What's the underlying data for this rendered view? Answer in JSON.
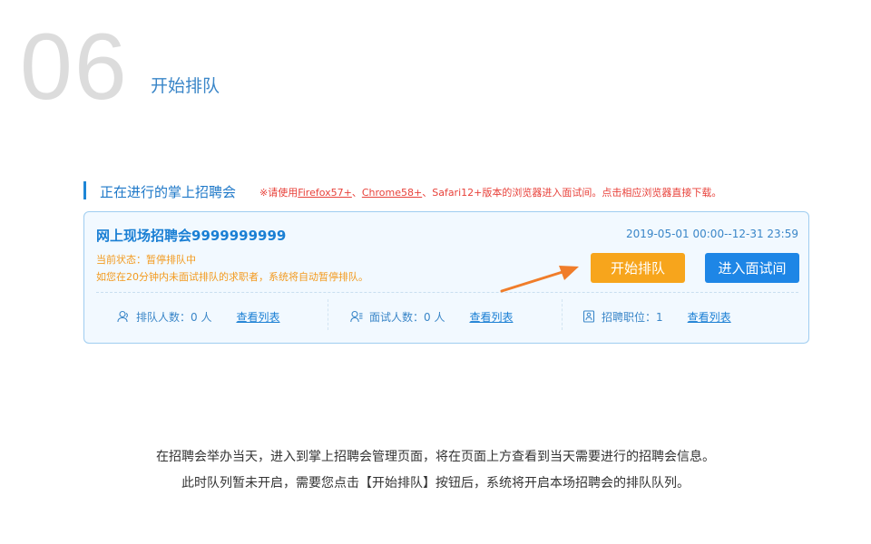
{
  "step": {
    "number": "06",
    "title": "开始排队"
  },
  "section": {
    "title": "正在进行的掌上招聘会",
    "notice_prefix": "※请使用",
    "browser_firefox": "Firefox57+",
    "sep1": "、",
    "browser_chrome": "Chrome58+",
    "notice_suffix": "、Safari12+版本的浏览器进入面试间。点击相应浏览器直接下载。"
  },
  "card": {
    "fair_name": "网上现场招聘会9999999999",
    "fair_time": "2019-05-01 00:00--12-31 23:59",
    "status": "当前状态：暂停排队中",
    "hint": "如您在20分钟内未面试排队的求职者，系统将自动暂停排队。",
    "buttons": {
      "start_queue": "开始排队",
      "enter_room": "进入面试间"
    },
    "stats": [
      {
        "label": "排队人数：0 人",
        "link": "查看列表",
        "icon": "user-queue-icon"
      },
      {
        "label": "面试人数：0 人",
        "link": "查看列表",
        "icon": "user-interview-icon"
      },
      {
        "label": "招聘职位：1",
        "link": "查看列表",
        "icon": "job-document-icon"
      }
    ]
  },
  "description": {
    "line1": "在招聘会举办当天，进入到掌上招聘会管理页面，将在页面上方查看到当天需要进行的招聘会信息。",
    "line2": "此时队列暂未开启，需要您点击【开始排队】按钮后，系统将开启本场招聘会的排队队列。"
  },
  "colors": {
    "accent": "#1e86e6",
    "orange": "#f7a51c",
    "warning_red": "#e8413a",
    "arrow": "#f07d2a"
  }
}
